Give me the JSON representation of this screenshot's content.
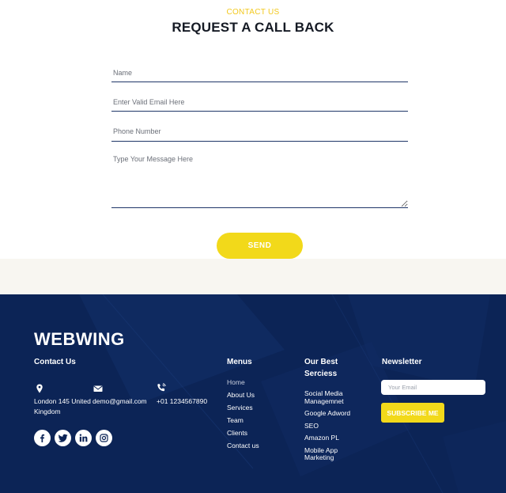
{
  "form": {
    "eyebrow": "CONTACT US",
    "heading": "REQUEST A CALL BACK",
    "name_placeholder": "Name",
    "email_placeholder": "Enter Valid Email Here",
    "phone_placeholder": "Phone Number",
    "message_placeholder": "Type Your Message Here",
    "send_label": "SEND"
  },
  "footer": {
    "logo": "WEBWING",
    "contact": {
      "title": "Contact Us",
      "address": "London 145 United Kingdom",
      "email": "demo@gmail.com",
      "phone": "+01 1234567890",
      "icons": [
        "map-marker-icon",
        "envelope-icon",
        "phone-icon"
      ],
      "social": [
        "facebook-icon",
        "twitter-icon",
        "linkedin-icon",
        "instagram-icon"
      ]
    },
    "menus": {
      "title": "Menus",
      "items": [
        "Home",
        "About Us",
        "Services",
        "Team",
        "Clients",
        "Contact us"
      ]
    },
    "services": {
      "title": "Our Best Serciess",
      "items": [
        "Social Media Managemnet",
        "Google Adword",
        "SEO",
        "Amazon PL",
        "Mobile App Marketing"
      ]
    },
    "newsletter": {
      "title": "Newsletter",
      "email_placeholder": "Your Email",
      "subscribe_label": "SUBSCRIBE ME"
    }
  },
  "colors": {
    "accent": "#f2d91a",
    "footer_bg": "#0c2456",
    "input_border": "#1f3668",
    "heading": "#151a24"
  }
}
